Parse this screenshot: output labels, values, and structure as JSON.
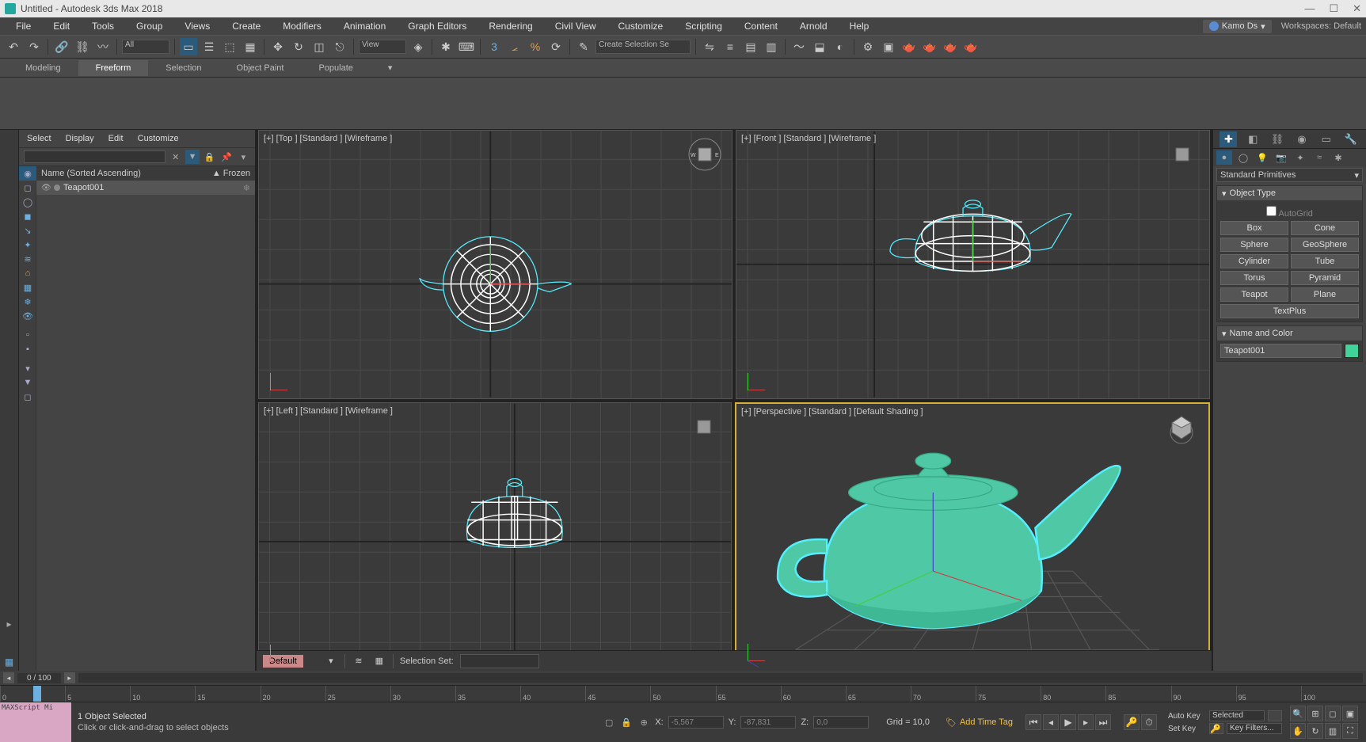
{
  "title": "Untitled - Autodesk 3ds Max 2018",
  "user": "Kamo Ds",
  "workspaces_label": "Workspaces:",
  "workspace": "Default",
  "menu": [
    "File",
    "Edit",
    "Tools",
    "Group",
    "Views",
    "Create",
    "Modifiers",
    "Animation",
    "Graph Editors",
    "Rendering",
    "Civil View",
    "Customize",
    "Scripting",
    "Content",
    "Arnold",
    "Help"
  ],
  "toolbar": {
    "all_filter": "All",
    "view_label": "View",
    "create_sel_set": "Create Selection Se"
  },
  "ribbon_tabs": [
    "Modeling",
    "Freeform",
    "Selection",
    "Object Paint",
    "Populate"
  ],
  "ribbon_active": 1,
  "scene_explorer": {
    "menu": [
      "Select",
      "Display",
      "Edit",
      "Customize"
    ],
    "header_name": "Name (Sorted Ascending)",
    "header_frozen": "▲ Frozen",
    "items": [
      {
        "name": "Teapot001"
      }
    ]
  },
  "viewports": {
    "top": "[+] [Top ] [Standard ] [Wireframe ]",
    "front": "[+] [Front ] [Standard ] [Wireframe ]",
    "left": "[+] [Left ] [Standard ] [Wireframe ]",
    "persp": "[+] [Perspective ] [Standard ] [Default Shading ]"
  },
  "vptoolbar": {
    "layer": "Default",
    "selset_label": "Selection Set:"
  },
  "command_panel": {
    "category": "Standard Primitives",
    "rollout_object_type": "Object Type",
    "autogrid": "AutoGrid",
    "buttons": [
      "Box",
      "Cone",
      "Sphere",
      "GeoSphere",
      "Cylinder",
      "Tube",
      "Torus",
      "Pyramid",
      "Teapot",
      "Plane",
      "TextPlus"
    ],
    "rollout_name": "Name and Color",
    "object_name": "Teapot001"
  },
  "time": {
    "slider": "0 / 100",
    "ticks": [
      "0",
      "5",
      "10",
      "15",
      "20",
      "25",
      "30",
      "35",
      "40",
      "45",
      "50",
      "55",
      "60",
      "65",
      "70",
      "75",
      "80",
      "85",
      "90",
      "95",
      "100"
    ]
  },
  "status": {
    "script": "MAXScript Mi",
    "line1": "1 Object Selected",
    "line2": "Click or click-and-drag to select objects",
    "x_label": "X:",
    "x": "-5,567",
    "y_label": "Y:",
    "y": "-87,831",
    "z_label": "Z:",
    "z": "0,0",
    "grid": "Grid = 10,0",
    "add_time_tag": "Add Time Tag",
    "autokey": "Auto Key",
    "autokey_mode": "Selected",
    "setkey": "Set Key",
    "keyfilters": "Key Filters..."
  }
}
